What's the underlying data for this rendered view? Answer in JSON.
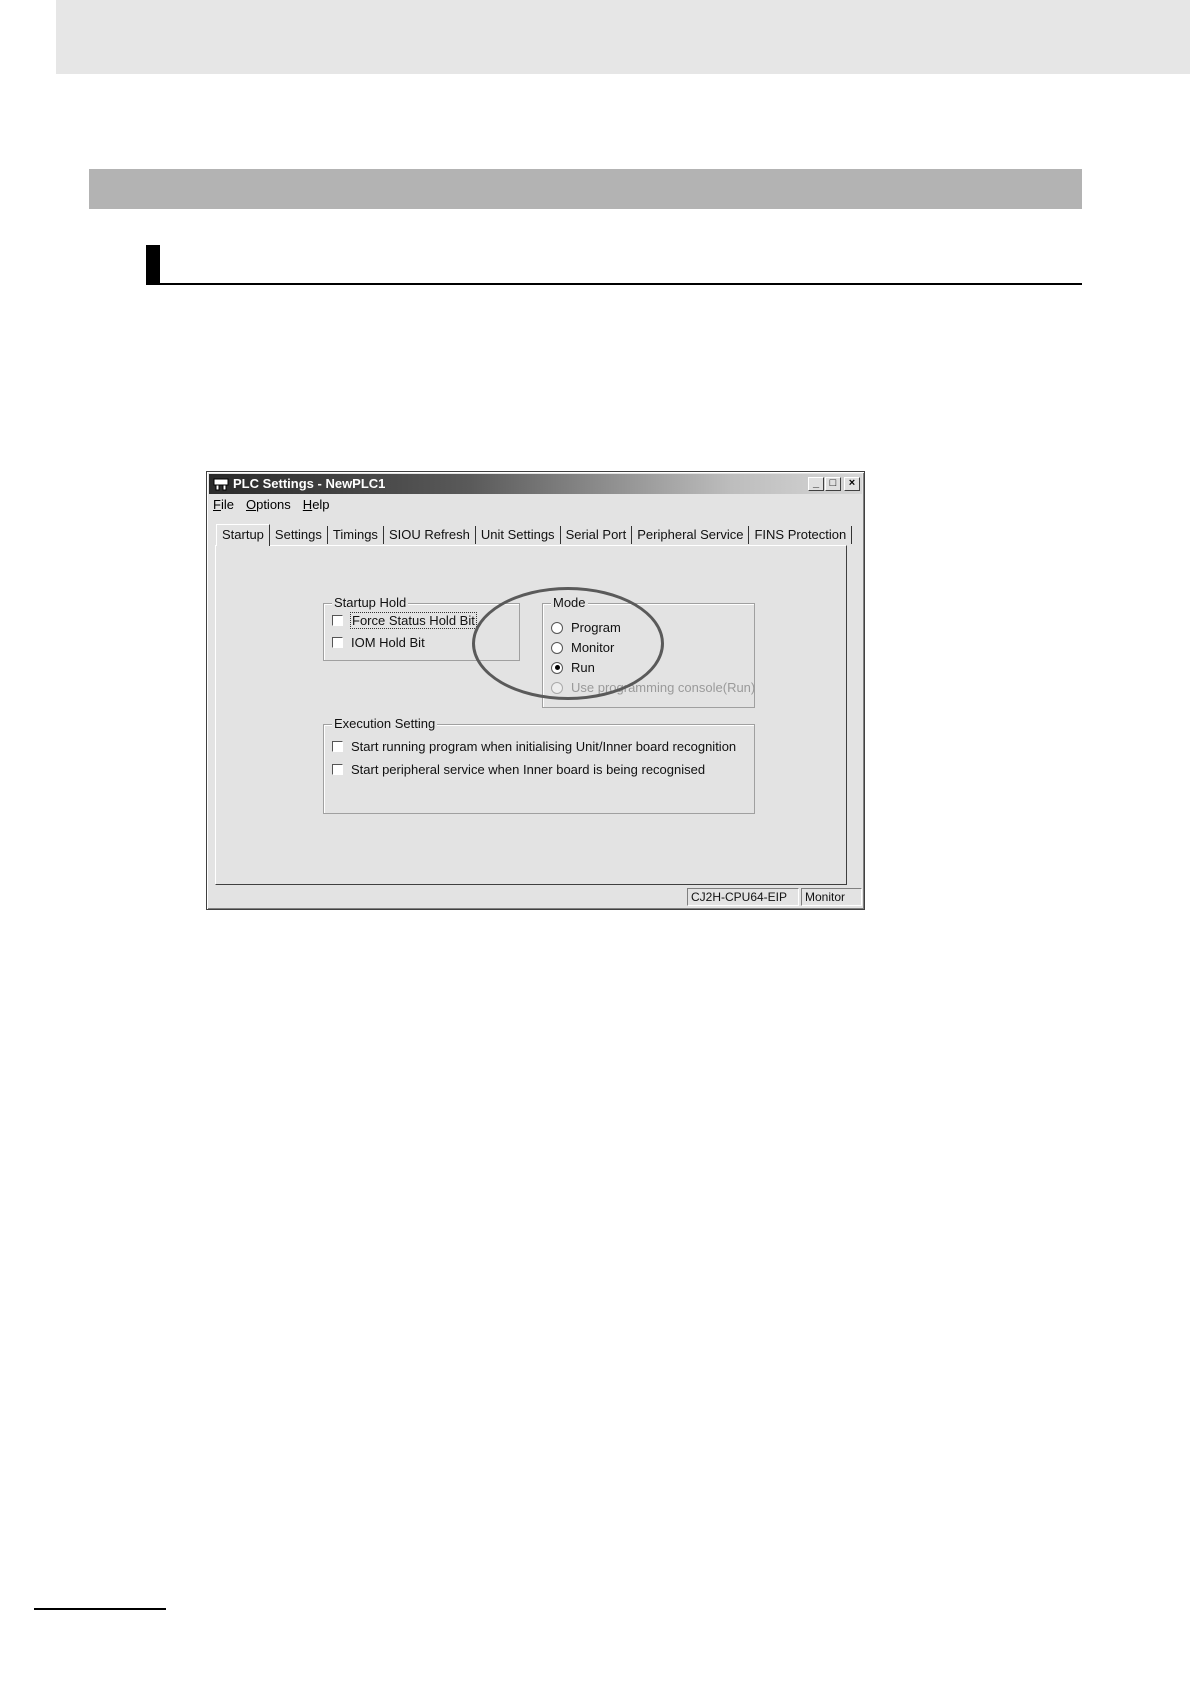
{
  "window": {
    "title": "PLC Settings - NewPLC1",
    "controls": {
      "minimize": "_",
      "maximize": "□",
      "close": "×"
    }
  },
  "menu": [
    {
      "label": "File",
      "accel": "F",
      "rest": "ile"
    },
    {
      "label": "Options",
      "accel": "O",
      "rest": "ptions"
    },
    {
      "label": "Help",
      "accel": "H",
      "rest": "elp"
    }
  ],
  "tabs": [
    "Startup",
    "Settings",
    "Timings",
    "SIOU Refresh",
    "Unit Settings",
    "Serial Port",
    "Peripheral Service",
    "FINS Protection"
  ],
  "active_tab": "Startup",
  "startup_hold": {
    "label": "Startup Hold",
    "options": [
      {
        "label": "Force Status Hold Bit",
        "checked": false
      },
      {
        "label": "IOM Hold Bit",
        "checked": false
      }
    ]
  },
  "mode": {
    "label": "Mode",
    "options": [
      {
        "label": "Program",
        "selected": false,
        "enabled": true
      },
      {
        "label": "Monitor",
        "selected": false,
        "enabled": true
      },
      {
        "label": "Run",
        "selected": true,
        "enabled": true
      },
      {
        "label": "Use programming console(Run)",
        "selected": false,
        "enabled": false
      }
    ]
  },
  "execution_setting": {
    "label": "Execution Setting",
    "options": [
      {
        "label": "Start running program when initialising Unit/Inner board recognition",
        "checked": false
      },
      {
        "label": "Start peripheral service when Inner board is being recognised",
        "checked": false
      }
    ]
  },
  "status_bar": {
    "model": "CJ2H-CPU64-EIP",
    "mode": "Monitor"
  }
}
